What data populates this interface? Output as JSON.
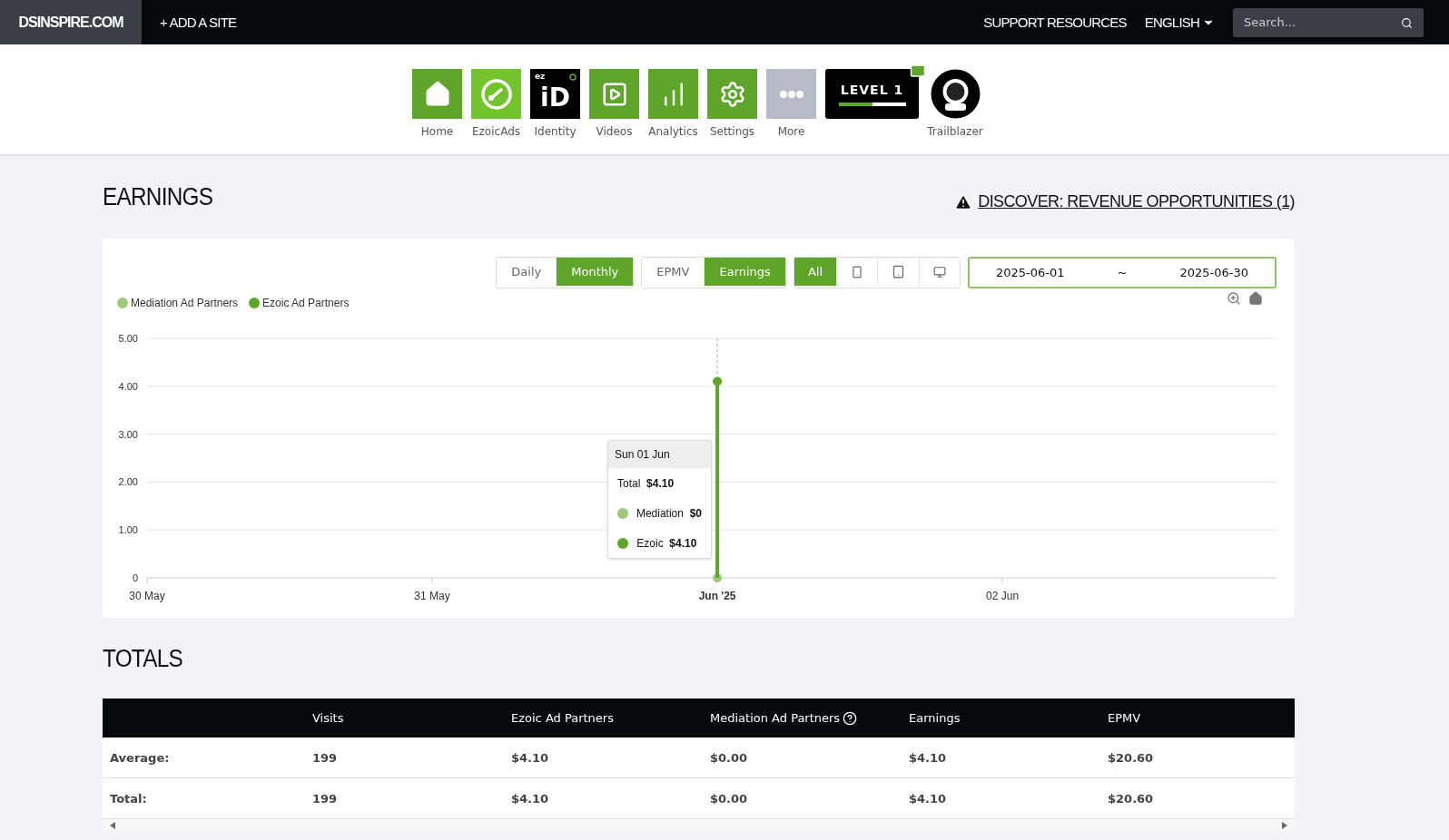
{
  "top_bar": {
    "site": "DSINSPIRE.COM",
    "add_site": "+ ADD A SITE",
    "support": "SUPPORT RESOURCES",
    "language": "ENGLISH",
    "search": {
      "placeholder": "Search..."
    }
  },
  "nav_icons": [
    {
      "kind": "home",
      "label": "Home"
    },
    {
      "kind": "ezoicads",
      "label": "EzoicAds"
    },
    {
      "kind": "identity",
      "label": "Identity",
      "badge": "ez",
      "mark": "iD"
    },
    {
      "kind": "videos",
      "label": "Videos"
    },
    {
      "kind": "analytics",
      "label": "Analytics"
    },
    {
      "kind": "settings",
      "label": "Settings"
    },
    {
      "kind": "more",
      "label": "More"
    }
  ],
  "level_badge": {
    "title": "LEVEL 1",
    "level": 0.5
  },
  "trailblazer": {
    "label": "Trailblazer"
  },
  "earnings": {
    "title": "EARNINGS",
    "discover_link": "DISCOVER: REVENUE OPPORTUNITIES (1)",
    "period_tabs": [
      {
        "label": "Daily",
        "selected": false
      },
      {
        "label": "Monthly",
        "selected": true
      }
    ],
    "metric_tabs": [
      {
        "label": "EPMV",
        "selected": false
      },
      {
        "label": "Earnings",
        "selected": true
      }
    ],
    "device_tabs": [
      {
        "kind": "all",
        "label": "All",
        "selected": true
      },
      {
        "kind": "mobile",
        "selected": false
      },
      {
        "kind": "tablet",
        "selected": false
      },
      {
        "kind": "desktop",
        "selected": false
      }
    ],
    "date_range": {
      "start": "2025-06-01",
      "separator": "~",
      "end": "2025-06-30"
    },
    "chart_data": {
      "type": "scatter",
      "grid": true,
      "ref_lines": [
        {
          "axis": "x",
          "value": "Jun '25"
        }
      ],
      "categories": [
        "30 May",
        "31 May",
        "Jun '25",
        "02 Jun"
      ],
      "series": [
        {
          "name": "Mediation Ad Partners",
          "color": "#9dc97a",
          "values": [
            null,
            null,
            0,
            null
          ]
        },
        {
          "name": "Ezoic Ad Partners",
          "color": "#5fa52a",
          "values": [
            null,
            null,
            4.1,
            null
          ]
        }
      ],
      "ylim": [
        0,
        5
      ],
      "yticks": [
        {
          "value": 0,
          "label": "0"
        },
        {
          "value": 1,
          "label": "1.00"
        },
        {
          "value": 2,
          "label": "2.00"
        },
        {
          "value": 3,
          "label": "3.00"
        },
        {
          "value": 4,
          "label": "4.00"
        },
        {
          "value": 5,
          "label": "5.00"
        }
      ]
    },
    "tooltip": {
      "title": "Sun 01 Jun",
      "total_label": "Total",
      "total_value": "$4.10",
      "rows": [
        {
          "label": "Mediation",
          "value": "$0",
          "color": "#9dc97a"
        },
        {
          "label": "Ezoic",
          "value": "$4.10",
          "color": "#5fa52a"
        }
      ]
    }
  },
  "totals": {
    "title": "TOTALS",
    "columns": [
      {
        "label": "Visits",
        "help": false
      },
      {
        "label": "Ezoic Ad Partners",
        "help": false
      },
      {
        "label": "Mediation Ad Partners",
        "help": true
      },
      {
        "label": "Earnings",
        "help": false
      },
      {
        "label": "EPMV",
        "help": false
      }
    ],
    "rows": [
      {
        "label": "Average:",
        "cells": [
          "199",
          "$4.10",
          "$0.00",
          "$4.10",
          "$20.60"
        ]
      },
      {
        "label": "Total:",
        "cells": [
          "199",
          "$4.10",
          "$0.00",
          "$4.10",
          "$20.60"
        ]
      }
    ]
  }
}
